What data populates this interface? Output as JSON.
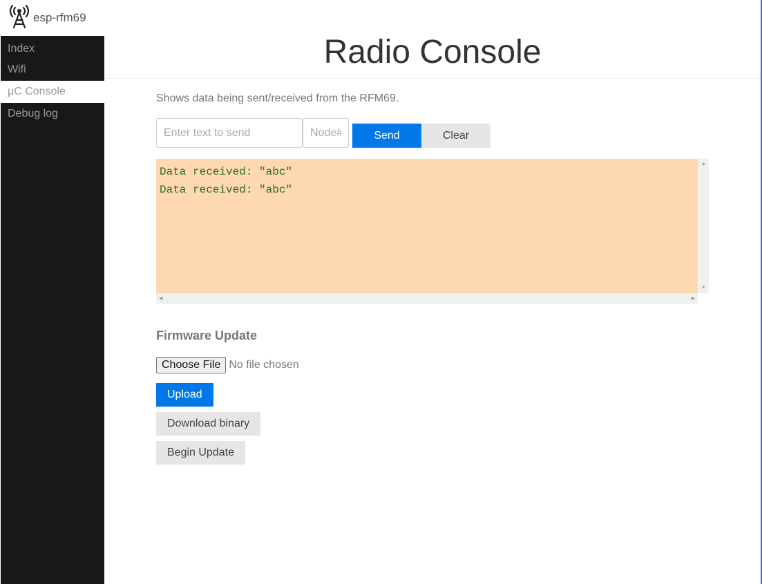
{
  "brand": {
    "name": "esp-rfm69",
    "icon": "radio-tower-icon"
  },
  "nav": {
    "items": [
      {
        "label": "Index"
      },
      {
        "label": "Wifi"
      },
      {
        "label": "µC Console"
      },
      {
        "label": "Debug log"
      }
    ],
    "active_index": 2
  },
  "header": {
    "title": "Radio Console"
  },
  "main": {
    "description": "Shows data being sent/received from the RFM69.",
    "send_form": {
      "text_placeholder": "Enter text to send",
      "text_value": "",
      "node_placeholder": "Node#",
      "node_value": "",
      "send_label": "Send",
      "clear_label": "Clear"
    },
    "console_lines": [
      "Data received: \"abc\"",
      "Data received: \"abc\""
    ],
    "firmware": {
      "title": "Firmware Update",
      "choose_file_label": "Choose File",
      "no_file_text": "No file chosen",
      "upload_label": "Upload",
      "download_label": "Download binary",
      "begin_label": "Begin Update"
    }
  },
  "colors": {
    "accent": "#0078e7",
    "sidebar_bg": "#191818",
    "console_bg": "#fdd8b0",
    "console_text": "#2e6f1e"
  }
}
